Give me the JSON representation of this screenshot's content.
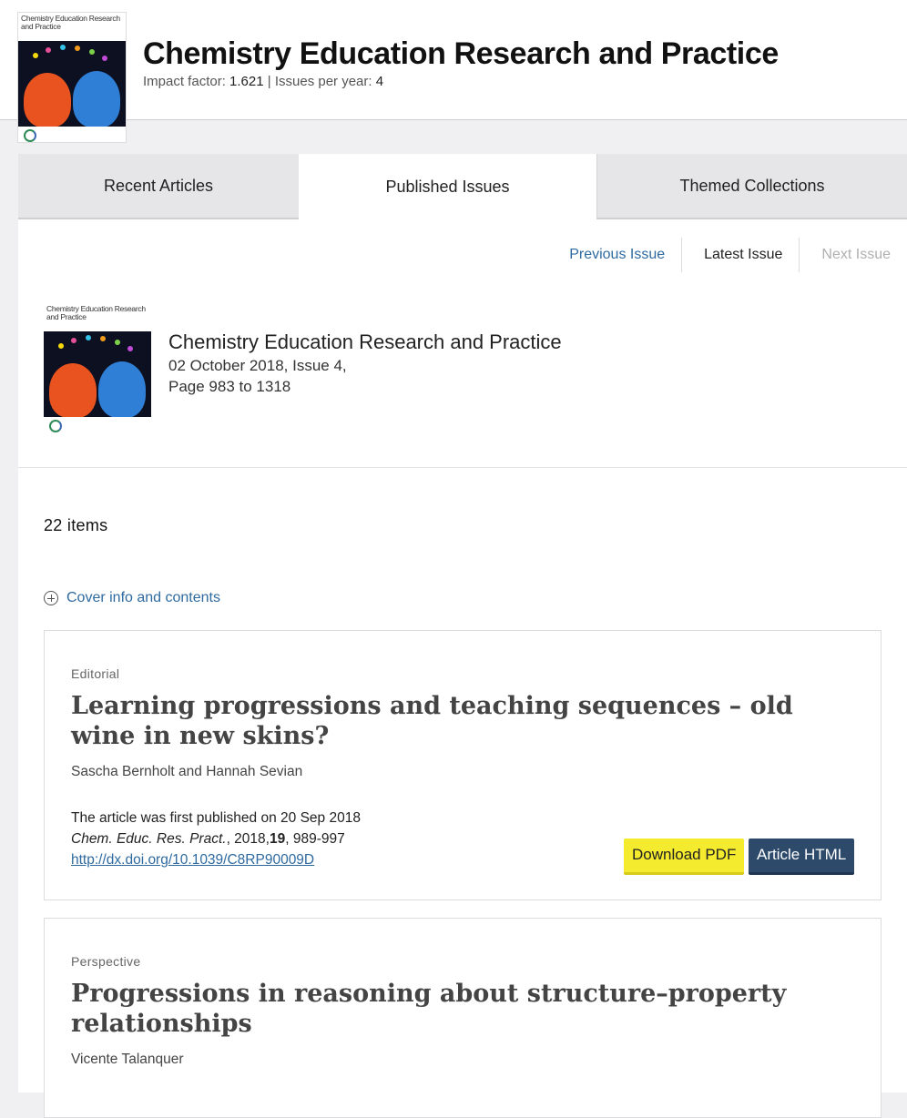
{
  "header": {
    "title": "Chemistry Education Research and Practice",
    "impact_label": "Impact factor:",
    "impact_value": "1.621",
    "separator": "|",
    "issues_label": "Issues per year:",
    "issues_value": "4",
    "cover_text": "Chemistry Education Research and Practice"
  },
  "tabs": [
    {
      "label": "Recent Articles",
      "active": false
    },
    {
      "label": "Published Issues",
      "active": true
    },
    {
      "label": "Themed Collections",
      "active": false
    }
  ],
  "issue_nav": {
    "previous": "Previous Issue",
    "latest": "Latest Issue",
    "next": "Next Issue"
  },
  "issue": {
    "journal": "Chemistry Education Research and Practice",
    "date": "02 October 2018, Issue 4,",
    "pages": "Page 983 to 1318",
    "cover_text": "Chemistry Education Research and Practice"
  },
  "items_count": "22 items",
  "cover_info_label": "Cover info and contents",
  "articles": [
    {
      "type": "Editorial",
      "title": "Learning progressions and teaching sequences – old wine in new skins?",
      "authors": "Sascha Bernholt and Hannah Sevian",
      "first_published": "The article was first published on 20 Sep 2018",
      "citation_journal": "Chem. Educ. Res. Pract.",
      "citation_year": ", 2018,",
      "citation_volume": "19",
      "citation_pages": ", 989-997",
      "doi": "http://dx.doi.org/10.1039/C8RP90009D",
      "pdf_label": "Download PDF",
      "html_label": "Article HTML"
    },
    {
      "type": "Perspective",
      "title": "Progressions in reasoning about structure–property relationships",
      "authors": "Vicente Talanquer"
    }
  ],
  "colors": {
    "link": "#2e6aa0",
    "pdf_button": "#f4ea2e",
    "html_button": "#2d4a6b",
    "page_bg": "#f0f0f2"
  }
}
